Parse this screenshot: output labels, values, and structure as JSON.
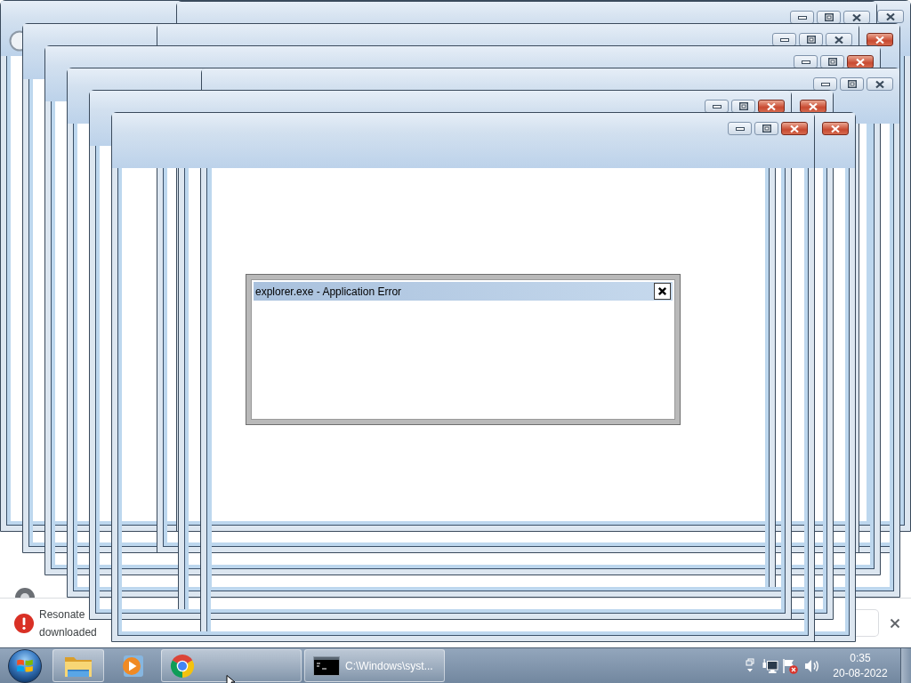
{
  "windows": [
    {
      "active": false,
      "controls": [
        {
          "kind": "close"
        }
      ]
    },
    {
      "active": false,
      "controls": [
        {
          "kind": "minimize"
        },
        {
          "kind": "maximize"
        },
        {
          "kind": "close"
        }
      ]
    },
    {
      "active": true,
      "controls": [
        {
          "kind": "close"
        }
      ]
    },
    {
      "active": false,
      "controls": [
        {
          "kind": "minimize"
        },
        {
          "kind": "maximize"
        },
        {
          "kind": "close"
        }
      ]
    },
    {
      "active": true,
      "controls": [
        {
          "kind": "minimize"
        },
        {
          "kind": "maximize"
        },
        {
          "kind": "close"
        }
      ]
    },
    {
      "active": false,
      "controls": [
        {
          "kind": "minimize"
        },
        {
          "kind": "maximize"
        },
        {
          "kind": "close"
        }
      ]
    },
    {
      "active": true,
      "controls": [
        {
          "kind": "close"
        }
      ]
    },
    {
      "active": true,
      "controls": [
        {
          "kind": "minimize"
        },
        {
          "kind": "maximize"
        },
        {
          "kind": "close"
        }
      ]
    },
    {
      "active": true,
      "controls": [
        {
          "kind": "close"
        }
      ]
    },
    {
      "active": true,
      "controls": [
        {
          "kind": "minimize"
        },
        {
          "kind": "maximize"
        },
        {
          "kind": "close"
        }
      ]
    }
  ],
  "error_dialog": {
    "title": "explorer.exe - Application Error"
  },
  "notification": {
    "lines": [
      "Resonate",
      "downloaded"
    ]
  },
  "taskbar": {
    "items": [
      {
        "kind": "folder",
        "running": false,
        "highlighted": true
      },
      {
        "kind": "player",
        "running": false,
        "highlighted": false
      },
      {
        "kind": "browser",
        "running": true,
        "highlighted": true
      },
      {
        "kind": "console",
        "running": true,
        "highlighted": true,
        "label": "C:\\Windows\\syst..."
      }
    ]
  },
  "tray": {
    "alert": true,
    "time": "0:35",
    "date": "20-08-2022"
  }
}
